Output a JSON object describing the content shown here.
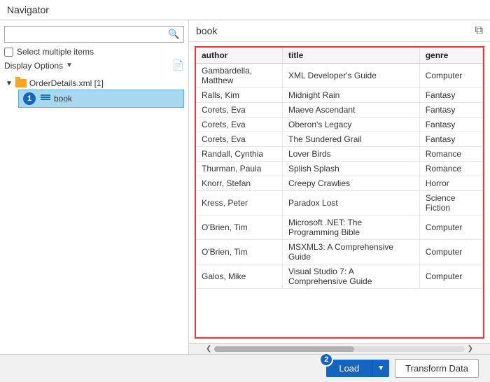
{
  "app": {
    "title": "Navigator"
  },
  "left_panel": {
    "search_placeholder": "",
    "select_multiple_label": "Select multiple items",
    "display_options_label": "Display Options",
    "tree": {
      "root_label": "OrderDetails.xml [1]",
      "child_label": "book"
    }
  },
  "right_panel": {
    "table_title": "book",
    "columns": [
      "author",
      "title",
      "genre"
    ],
    "rows": [
      {
        "author": "Gambardella, Matthew",
        "title": "XML Developer's Guide",
        "genre": "Computer"
      },
      {
        "author": "Ralls, Kim",
        "title": "Midnight Rain",
        "genre": "Fantasy"
      },
      {
        "author": "Corets, Eva",
        "title": "Maeve Ascendant",
        "genre": "Fantasy"
      },
      {
        "author": "Corets, Eva",
        "title": "Oberon's Legacy",
        "genre": "Fantasy"
      },
      {
        "author": "Corets, Eva",
        "title": "The Sundered Grail",
        "genre": "Fantasy"
      },
      {
        "author": "Randall, Cynthia",
        "title": "Lover Birds",
        "genre": "Romance"
      },
      {
        "author": "Thurman, Paula",
        "title": "Splish Splash",
        "genre": "Romance"
      },
      {
        "author": "Knorr, Stefan",
        "title": "Creepy Crawlies",
        "genre": "Horror"
      },
      {
        "author": "Kress, Peter",
        "title": "Paradox Lost",
        "genre": "Science Fiction"
      },
      {
        "author": "O'Brien, Tim",
        "title": "Microsoft .NET: The Programming Bible",
        "genre": "Computer"
      },
      {
        "author": "O'Brien, Tim",
        "title": "MSXML3: A Comprehensive Guide",
        "genre": "Computer"
      },
      {
        "author": "Galos, Mike",
        "title": "Visual Studio 7: A Comprehensive Guide",
        "genre": "Computer"
      }
    ]
  },
  "bottom_bar": {
    "load_label": "Load",
    "transform_data_label": "Transform Data",
    "load_badge": "2"
  },
  "icons": {
    "search": "🔍",
    "dropdown_arrow": "▼",
    "file_icon": "📄",
    "expand_right": "▶",
    "expand_down": "▼",
    "copy_icon": "⧉",
    "chevron_left": "❮",
    "chevron_right": "❯"
  }
}
